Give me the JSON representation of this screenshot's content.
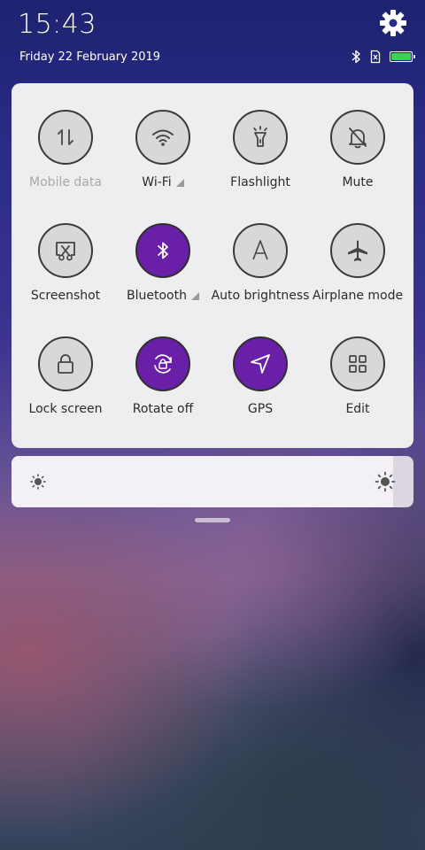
{
  "status": {
    "time": "15:43",
    "date": "Friday 22 February 2019",
    "icons": [
      "bluetooth-icon",
      "sim-missing-icon",
      "battery-icon"
    ],
    "battery_percent": 100,
    "battery_color": "#39d353"
  },
  "tiles": [
    {
      "label": "Mobile data",
      "icon": "mobile-data-icon",
      "active": false,
      "disabled": true
    },
    {
      "label": "Wi-Fi",
      "icon": "wifi-icon",
      "active": false,
      "expandable": true
    },
    {
      "label": "Flashlight",
      "icon": "flashlight-icon",
      "active": false
    },
    {
      "label": "Mute",
      "icon": "mute-bell-icon",
      "active": false
    },
    {
      "label": "Screenshot",
      "icon": "screenshot-icon",
      "active": false
    },
    {
      "label": "Bluetooth",
      "icon": "bluetooth-icon",
      "active": true,
      "expandable": true
    },
    {
      "label": "Auto brightness",
      "icon": "auto-brightness-icon",
      "active": false
    },
    {
      "label": "Airplane mode",
      "icon": "airplane-icon",
      "active": false
    },
    {
      "label": "Lock screen",
      "icon": "lock-icon",
      "active": false
    },
    {
      "label": "Rotate off",
      "icon": "rotate-lock-icon",
      "active": true
    },
    {
      "label": "GPS",
      "icon": "gps-arrow-icon",
      "active": true
    },
    {
      "label": "Edit",
      "icon": "edit-grid-icon",
      "active": false
    }
  ],
  "brightness": {
    "level": 0.95
  },
  "colors": {
    "active_tile": "#6a1fa8",
    "inactive_tile": "#d8d8db",
    "panel": "#eeeef1"
  }
}
